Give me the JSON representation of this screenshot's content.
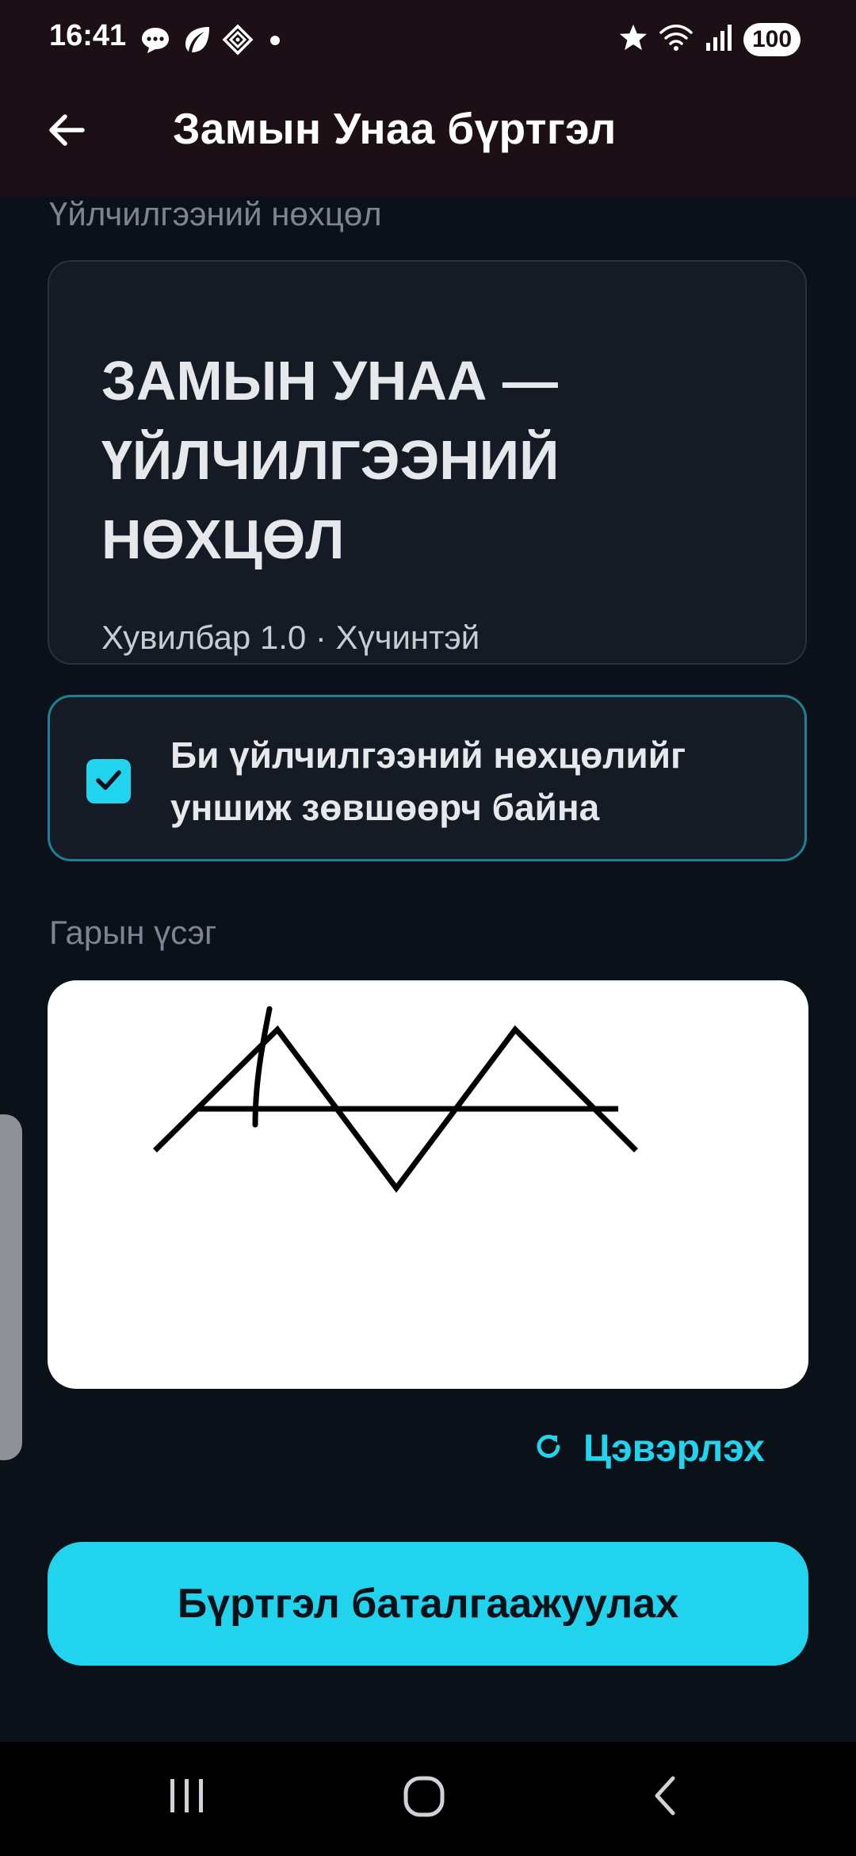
{
  "status_bar": {
    "time": "16:41",
    "battery": "100",
    "icons": [
      "chat-bubble-icon",
      "leaf-icon",
      "diamond-app-icon",
      "dot-icon",
      "star-icon",
      "wifi-icon",
      "signal-icon"
    ]
  },
  "app_bar": {
    "title": "Замын Унаа бүртгэл",
    "back_icon": "arrow-left-icon"
  },
  "terms": {
    "section_label": "Үйлчилгээний нөхцөл",
    "heading": "ЗАМЫН УНАА — ҮЙЛЧИЛГЭЭНИЙ НӨХЦӨЛ",
    "excerpt": "Хувилбар 1.0 · Хүчинтэй"
  },
  "agreement": {
    "checked": true,
    "label": "Би үйлчилгээний нөхцөлийг уншиж зөвшөөрч байна"
  },
  "signature": {
    "section_label": "Гарын үсэг"
  },
  "actions": {
    "clear_label": "Цэвэрлэх",
    "clear_icon": "refresh-icon",
    "confirm_label": "Бүртгэл баталгаажуулах"
  },
  "colors": {
    "accent": "#22d3ee",
    "background": "#0b1119",
    "topbar": "#1c1016",
    "card": "#151b24"
  },
  "nav_bar": {
    "icons": [
      "recent-apps-icon",
      "home-icon",
      "back-nav-icon"
    ]
  }
}
